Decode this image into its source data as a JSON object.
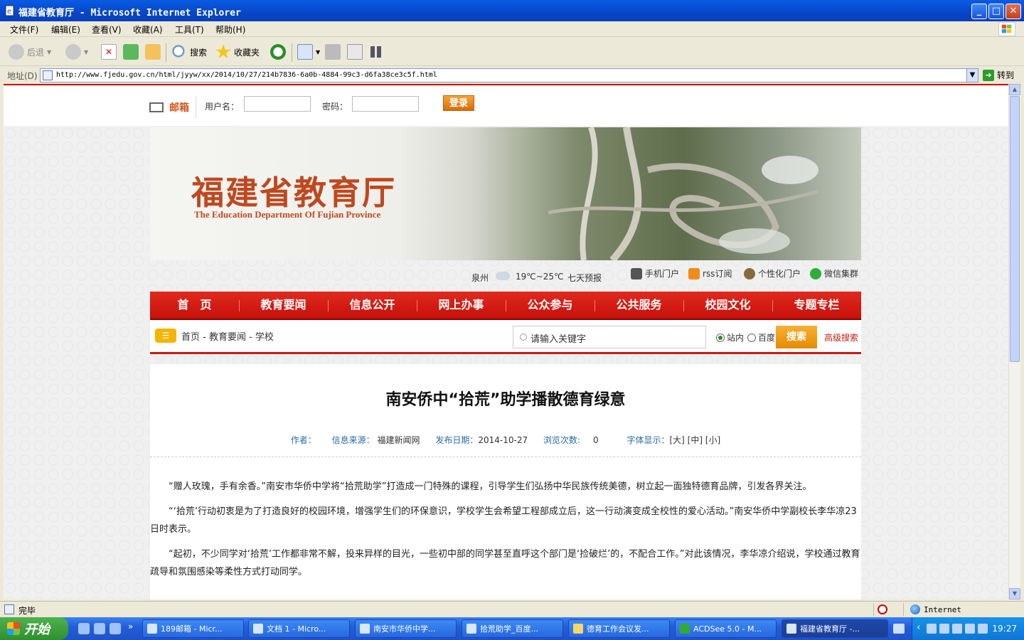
{
  "window": {
    "title": "福建省教育厅 - Microsoft Internet Explorer",
    "controls": [
      "_",
      "□",
      "✕"
    ]
  },
  "menu": [
    "文件(F)",
    "编辑(E)",
    "查看(V)",
    "收藏(A)",
    "工具(T)",
    "帮助(H)"
  ],
  "toolbar": {
    "back": "后退",
    "search": "搜索",
    "favorites": "收藏夹"
  },
  "address": {
    "label": "地址(D)",
    "url": "http://www.fjedu.gov.cn/html/jyyw/xx/2014/10/27/214b7836-6a0b-4884-99c3-d6fa38ce3c5f.html",
    "go": "转到"
  },
  "login": {
    "mail_label": "邮箱",
    "username_label": "用户名：",
    "password_label": "密码：",
    "login_button": "登录"
  },
  "banner": {
    "name_cn": "福建省教育厅",
    "name_en": "The Education Department Of Fujian Province"
  },
  "info": {
    "city": "泉州",
    "temp": "19℃~25℃",
    "forecast": "七天预报",
    "links": [
      "手机门户",
      "rss订阅",
      "个性化门户",
      "微信集群"
    ]
  },
  "nav": [
    "首　页",
    "教育要闻",
    "信息公开",
    "网上办事",
    "公众参与",
    "公共服务",
    "校园文化",
    "专题专栏"
  ],
  "breadcrumb": "首页 - 教育要闻 - 学校",
  "search": {
    "placeholder": "请输入关键字",
    "opt_site": "站内",
    "opt_baidu": "百度",
    "button": "搜索",
    "advanced": "高级搜索"
  },
  "article": {
    "title": "南安侨中“拾荒”助学播散德育绿意",
    "meta": {
      "author_label": "作者：",
      "source_label": "信息来源：",
      "source": "福建新闻网",
      "date_label": "发布日期：",
      "date": "2014-10-27",
      "views_label": "浏览次数:",
      "views": "0",
      "font_label": "字体显示：",
      "font_opts": "[大] [中] [小]"
    },
    "paragraphs": [
      "“赠人玫瑰，手有余香。”南安市华侨中学将“拾荒助学”打造成一门特殊的课程，引导学生们弘扬中华民族传统美德，树立起一面独特德育品牌，引发各界关注。",
      "“‘拾荒’行动初衷是为了打造良好的校园环境，增强学生们的环保意识，学校学生会希望工程部成立后，这一行动演变成全校性的爱心活动。”南安华侨中学副校长李华凉23日时表示。",
      "“起初，不少同学对‘拾荒’工作都非常不解，投来异样的目光，一些初中部的同学甚至直呼这个部门是‘捡破烂’的，不配合工作。”对此该情况，李华凉介绍说，学校通过教育疏导和氛围感染等柔性方式打动同学。"
    ]
  },
  "status": {
    "text": "完毕",
    "zone": "Internet"
  },
  "taskbar": {
    "start": "开始",
    "tasks": [
      "189邮箱 - Micr...",
      "文档 1 - Micro...",
      "南安市华侨中学...",
      "拾荒助学_百度...",
      "德育工作会议发...",
      "ACDSee 5.0 - M...",
      "福建省教育厅 -..."
    ],
    "clock": "19:27"
  }
}
